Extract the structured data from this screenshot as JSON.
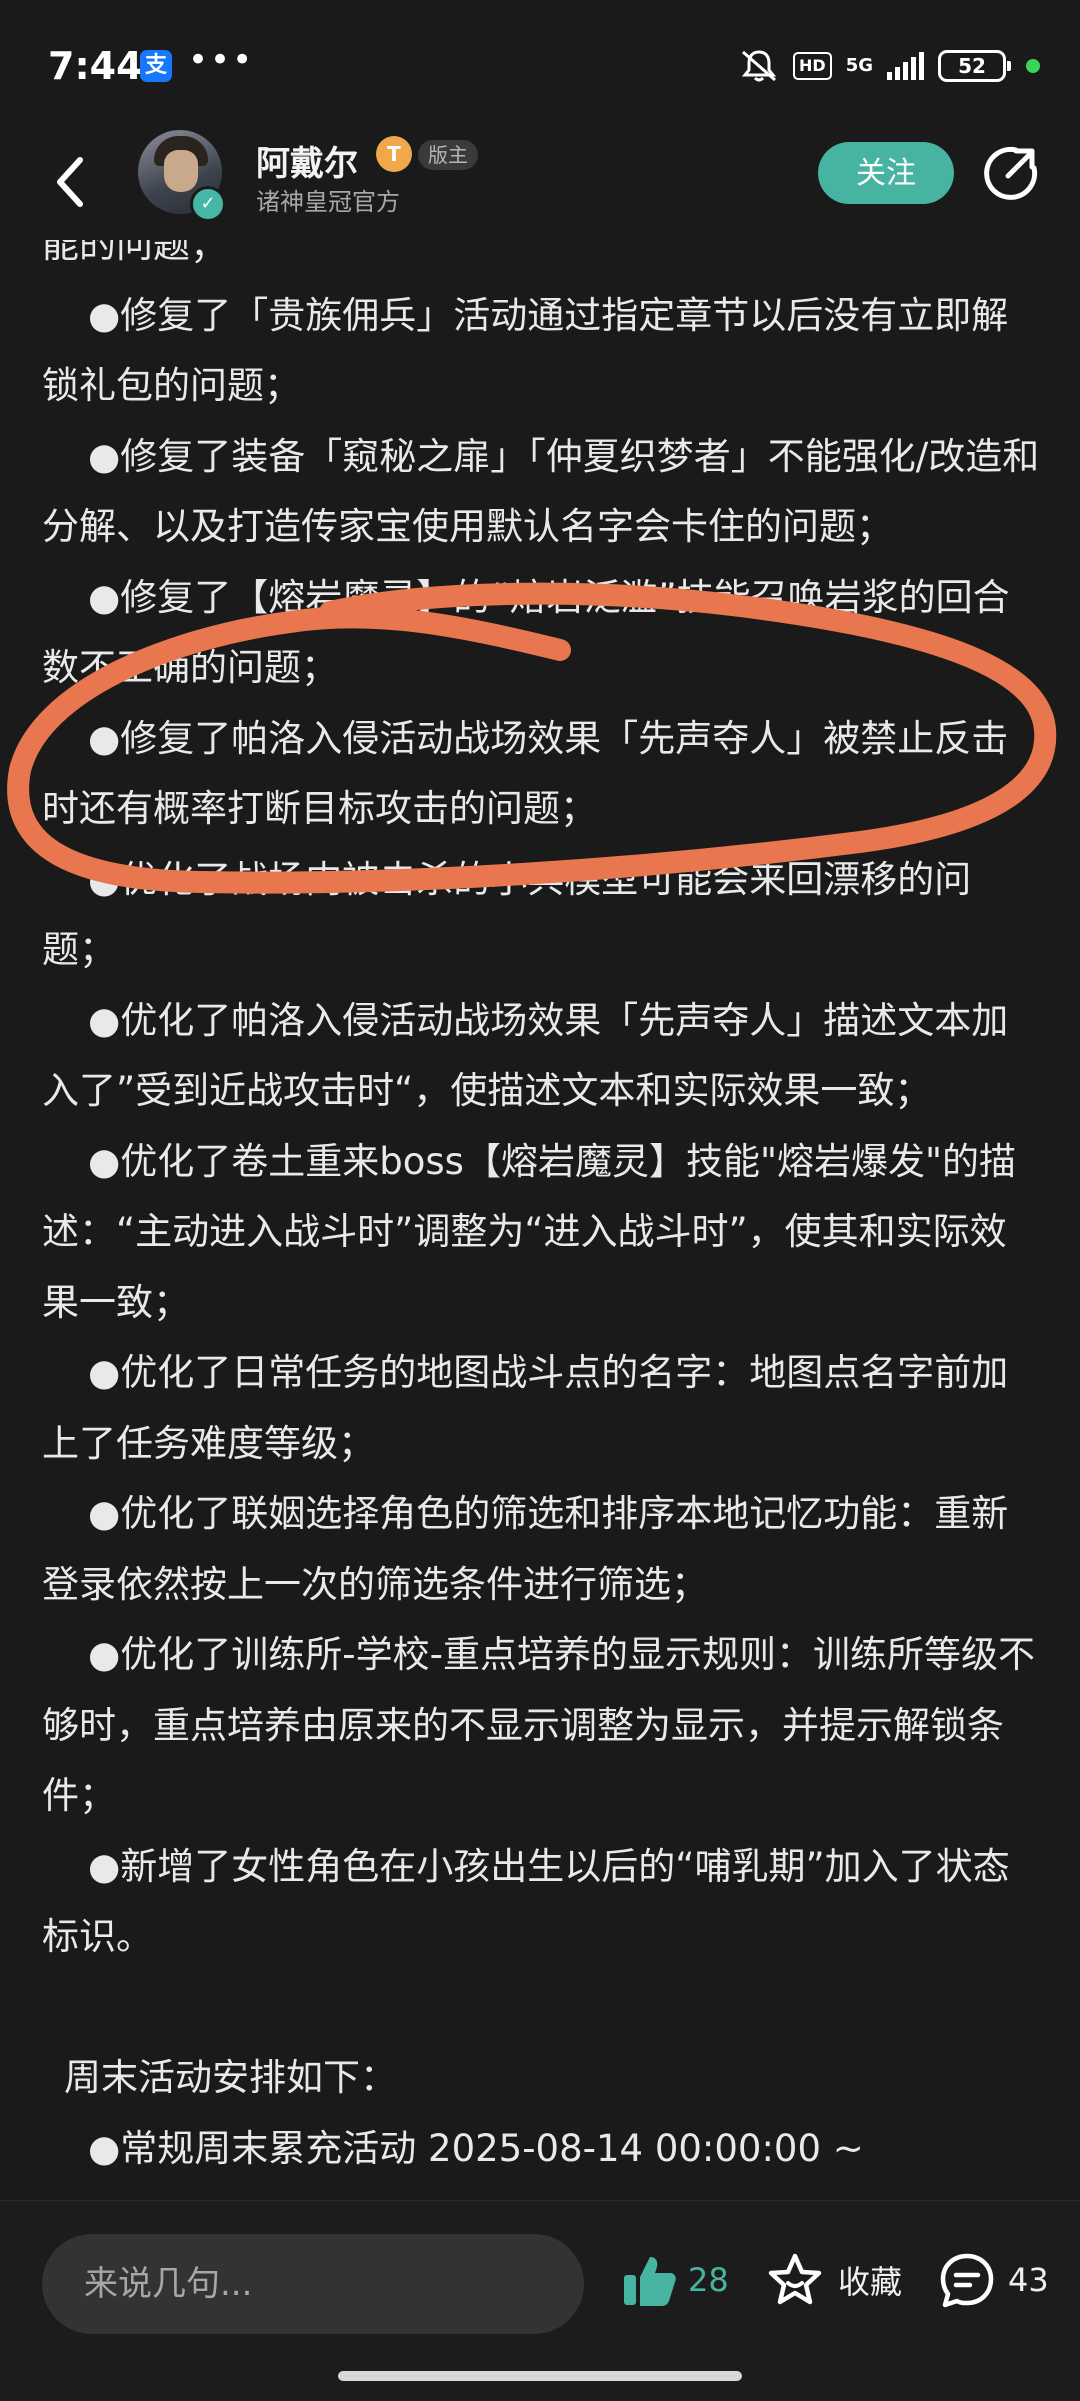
{
  "status": {
    "time": "7:44",
    "notification_app": "支",
    "more": "•••",
    "hd": "HD",
    "network": "5G",
    "battery": "52"
  },
  "header": {
    "author_name": "阿戴尔",
    "level_badge": "T",
    "role_badge": "版主",
    "subtitle": "诸神皇冠官方",
    "follow_label": "关注"
  },
  "article": {
    "lines": [
      {
        "text": "能的问题；",
        "style": "cont"
      },
      {
        "text": "●修复了「贵族佣兵」活动通过指定章节以后没有立即解锁礼包的问题；",
        "style": "item"
      },
      {
        "text": "●修复了装备「窥秘之扉」「仲夏织梦者」不能强化/改造和分解、以及打造传家宝使用默认名字会卡住的问题；",
        "style": "item"
      },
      {
        "text": "●修复了【熔岩魔灵】的“熔岩泛滥”技能召唤岩浆的回合数不正确的问题；",
        "style": "item"
      },
      {
        "text": "●修复了帕洛入侵活动战场效果「先声夺人」被禁止反击时还有概率打断目标攻击的问题；",
        "style": "item"
      },
      {
        "text": "●优化了战场内被击杀的小兵模型可能会来回漂移的问题；",
        "style": "item"
      },
      {
        "text": "●优化了帕洛入侵活动战场效果「先声夺人」描述文本加入了”受到近战攻击时“，使描述文本和实际效果一致；",
        "style": "item"
      },
      {
        "text": "●优化了卷土重来boss【熔岩魔灵】技能\"熔岩爆发\"的描述：“主动进入战斗时”调整为“进入战斗时”，使其和实际效果一致；",
        "style": "item"
      },
      {
        "text": "●优化了日常任务的地图战斗点的名字：地图点名字前加上了任务难度等级；",
        "style": "item"
      },
      {
        "text": "●优化了联姻选择角色的筛选和排序本地记忆功能：重新登录依然按上一次的筛选条件进行筛选；",
        "style": "item"
      },
      {
        "text": "●优化了训练所-学校-重点培养的显示规则：训练所等级不够时，重点培养由原来的不显示调整为显示，并提示解锁条件；",
        "style": "item"
      },
      {
        "text": "●新增了女性角色在小孩出生以后的“哺乳期”加入了状态标识。",
        "style": "item"
      },
      {
        "text": "",
        "style": "gap"
      },
      {
        "text": "周末活动安排如下：",
        "style": "sec"
      },
      {
        "text": "●常规周末累充活动 2025-08-14 00:00:00 ~",
        "style": "item"
      }
    ]
  },
  "annotation": {
    "color": "#e8764e"
  },
  "bottom": {
    "comment_placeholder": "来说几句...",
    "like_count": "28",
    "favorite_label": "收藏",
    "comment_count": "43"
  },
  "colors": {
    "accent": "#47b4a1",
    "background": "#1a1a1a",
    "text": "#e9e9e9"
  }
}
